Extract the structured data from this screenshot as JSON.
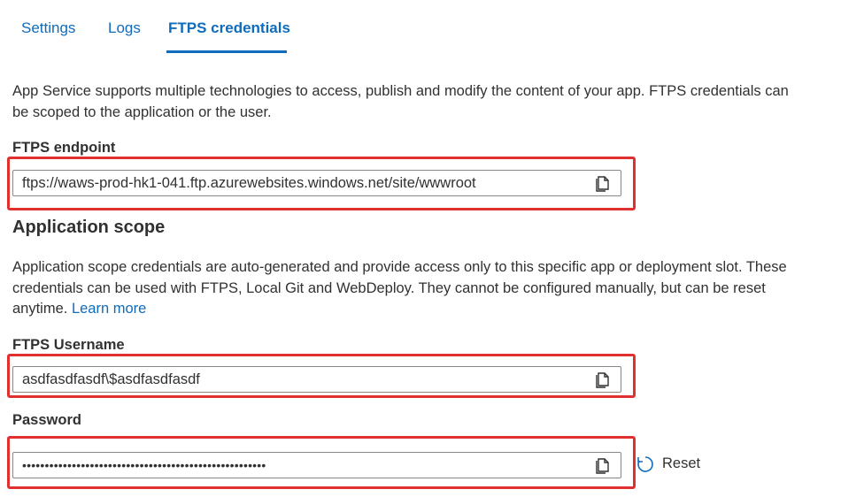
{
  "tabs": [
    {
      "label": "Settings"
    },
    {
      "label": "Logs"
    },
    {
      "label": "FTPS credentials",
      "active": true
    }
  ],
  "intro": {
    "line1": "App Service supports multiple technologies to access, publish and modify the content of your app. FTPS credentials can",
    "line2": "be scoped to the application or the user."
  },
  "endpoint": {
    "label": "FTPS endpoint",
    "value": "ftps://waws-prod-hk1-041.ftp.azurewebsites.windows.net/site/wwwroot"
  },
  "app_scope": {
    "heading": "Application scope",
    "line1": "Application scope credentials are auto-generated and provide access only to this specific app or deployment slot. These",
    "line2": "credentials can be used with FTPS, Local Git and WebDeploy. They cannot be configured manually, but can be reset",
    "line3": "anytime.",
    "learn_more": "Learn more"
  },
  "username": {
    "label": "FTPS Username",
    "value": "asdfasdfasdf\\$asdfasdfasdf"
  },
  "password": {
    "label": "Password",
    "value": "••••••••••••••••••••••••••••••••••••••••••••••••••••••"
  },
  "reset": {
    "label": "Reset"
  },
  "colors": {
    "accent": "#0f6cbd",
    "highlight": "#e03030"
  },
  "icons": {
    "copy": "copy-icon",
    "reset": "refresh-icon"
  }
}
